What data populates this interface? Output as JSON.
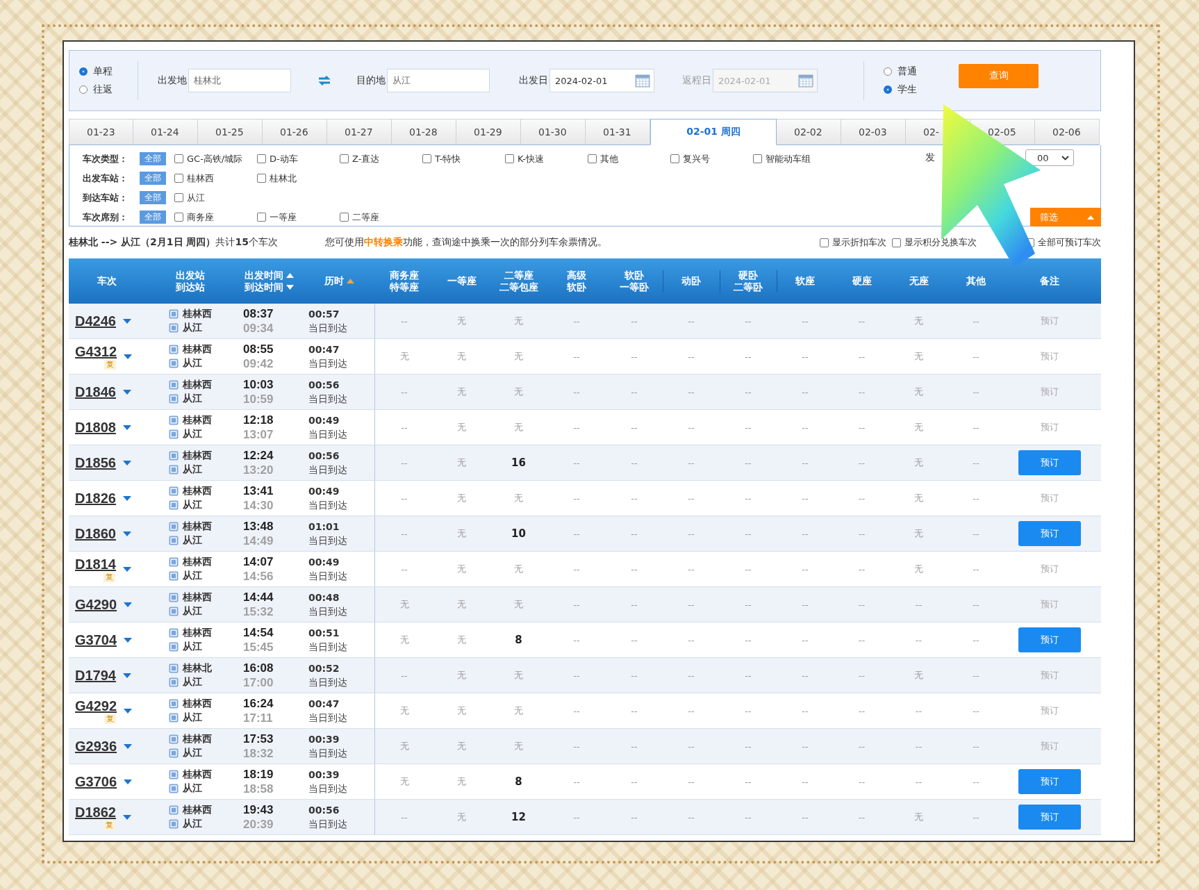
{
  "trip_type": [
    {
      "label": "单程",
      "selected": true
    },
    {
      "label": "往返",
      "selected": false
    }
  ],
  "from": {
    "label": "出发地",
    "value": "桂林北"
  },
  "to": {
    "label": "目的地",
    "value": "从江"
  },
  "depart_date": {
    "label": "出发日",
    "value": "2024-02-01",
    "disabled": false
  },
  "return_date": {
    "label": "返程日",
    "value": "2024-02-01",
    "disabled": true
  },
  "ticket_type": [
    {
      "label": "普通",
      "selected": false
    },
    {
      "label": "学生",
      "selected": true
    }
  ],
  "query_button": "查询",
  "date_tabs": [
    {
      "label": "01-23",
      "selected": false
    },
    {
      "label": "01-24",
      "selected": false
    },
    {
      "label": "01-25",
      "selected": false
    },
    {
      "label": "01-26",
      "selected": false
    },
    {
      "label": "01-27",
      "selected": false
    },
    {
      "label": "01-28",
      "selected": false
    },
    {
      "label": "01-29",
      "selected": false
    },
    {
      "label": "01-30",
      "selected": false
    },
    {
      "label": "01-31",
      "selected": false
    },
    {
      "label": "02-01 周四",
      "selected": true
    },
    {
      "label": "02-02",
      "selected": false
    },
    {
      "label": "02-03",
      "selected": false
    },
    {
      "label": "02-",
      "selected": false
    },
    {
      "label": "02-05",
      "selected": false
    },
    {
      "label": "02-06",
      "selected": false
    }
  ],
  "filters": [
    {
      "label": "车次类型：",
      "all": {
        "label": "全部",
        "selected": true
      },
      "options": [
        {
          "label": "GC-高铁/城际",
          "checked": false
        },
        {
          "label": "D-动车",
          "checked": false
        },
        {
          "label": "Z-直达",
          "checked": false
        },
        {
          "label": "T-特快",
          "checked": false
        },
        {
          "label": "K-快速",
          "checked": false
        },
        {
          "label": "其他",
          "checked": false
        },
        {
          "label": "复兴号",
          "checked": false
        },
        {
          "label": "智能动车组",
          "checked": false
        }
      ]
    },
    {
      "label": "出发车站：",
      "all": {
        "label": "全部",
        "selected": true
      },
      "options": [
        {
          "label": "桂林西",
          "checked": false
        },
        {
          "label": "桂林北",
          "checked": false
        }
      ]
    },
    {
      "label": "到达车站：",
      "all": {
        "label": "全部",
        "selected": true
      },
      "options": [
        {
          "label": "从江",
          "checked": false
        }
      ]
    },
    {
      "label": "车次席别：",
      "all": {
        "label": "全部",
        "selected": true
      },
      "options": [
        {
          "label": "商务座",
          "checked": false
        },
        {
          "label": "一等座",
          "checked": false
        },
        {
          "label": "二等座",
          "checked": false
        }
      ]
    }
  ],
  "depart_time": {
    "label": "发",
    "value": "00"
  },
  "filter_button": "筛选",
  "summary": "**桂林北 --> 从江（2月1日 周四）**共计**15**个车次",
  "notice": {
    "before": "您可使用",
    "link": "中转换乘",
    "after": "功能，查询途中换乘一次的部分列车余票情况。"
  },
  "display_options": [
    {
      "label": "显示折扣车次",
      "checked": false
    },
    {
      "label": "显示积分兑换车次",
      "checked": false
    },
    {
      "label": "全部可预订车次",
      "checked": false
    }
  ],
  "table": {
    "columns": [
      {
        "lines": [
          "车次"
        ]
      },
      {
        "lines": [
          "出发站",
          "到达站"
        ]
      },
      {
        "lines": [
          "出发时间",
          "到达时间"
        ],
        "sortable": true,
        "sort_active": false
      },
      {
        "lines": [
          "历时"
        ],
        "sortable": true,
        "sort_active": true
      },
      {
        "lines": [
          "商务座",
          "特等座"
        ]
      },
      {
        "lines": [
          "一等座"
        ]
      },
      {
        "lines": [
          "二等座",
          "二等包座"
        ]
      },
      {
        "lines": [
          "高级",
          "软卧"
        ]
      },
      {
        "lines": [
          "软卧",
          "一等卧"
        ]
      },
      {
        "lines": [
          "动卧"
        ]
      },
      {
        "lines": [
          "硬卧",
          "二等卧"
        ]
      },
      {
        "lines": [
          "软座"
        ]
      },
      {
        "lines": [
          "硬座"
        ]
      },
      {
        "lines": [
          "无座"
        ]
      },
      {
        "lines": [
          "其他"
        ]
      },
      {
        "lines": [
          "备注"
        ]
      }
    ],
    "rows": [
      {
        "train": "D4246",
        "from": "桂林西",
        "to": "从江",
        "depart": "08:37",
        "arrive": "09:34",
        "duration": "00:57",
        "arrival_day": "当日到达",
        "seats": [
          "--",
          "无",
          "无",
          "--",
          "--",
          "--",
          "--",
          "--",
          "--",
          "无",
          "--"
        ],
        "book": {
          "label": "预订",
          "enabled": false
        }
      },
      {
        "train": "G4312",
        "badge": "复",
        "from": "桂林西",
        "to": "从江",
        "depart": "08:55",
        "arrive": "09:42",
        "duration": "00:47",
        "arrival_day": "当日到达",
        "seats": [
          "无",
          "无",
          "无",
          "--",
          "--",
          "--",
          "--",
          "--",
          "--",
          "无",
          "--"
        ],
        "book": {
          "label": "预订",
          "enabled": false
        }
      },
      {
        "train": "D1846",
        "from": "桂林西",
        "to": "从江",
        "depart": "10:03",
        "arrive": "10:59",
        "duration": "00:56",
        "arrival_day": "当日到达",
        "seats": [
          "--",
          "无",
          "无",
          "--",
          "--",
          "--",
          "--",
          "--",
          "--",
          "无",
          "--"
        ],
        "book": {
          "label": "预订",
          "enabled": false
        }
      },
      {
        "train": "D1808",
        "from": "桂林西",
        "to": "从江",
        "depart": "12:18",
        "arrive": "13:07",
        "duration": "00:49",
        "arrival_day": "当日到达",
        "seats": [
          "--",
          "无",
          "无",
          "--",
          "--",
          "--",
          "--",
          "--",
          "--",
          "无",
          "--"
        ],
        "book": {
          "label": "预订",
          "enabled": false
        }
      },
      {
        "train": "D1856",
        "from": "桂林西",
        "to": "从江",
        "depart": "12:24",
        "arrive": "13:20",
        "duration": "00:56",
        "arrival_day": "当日到达",
        "seats": [
          "--",
          "无",
          "16",
          "--",
          "--",
          "--",
          "--",
          "--",
          "--",
          "无",
          "--"
        ],
        "book": {
          "label": "预订",
          "enabled": true
        }
      },
      {
        "train": "D1826",
        "from": "桂林西",
        "to": "从江",
        "depart": "13:41",
        "arrive": "14:30",
        "duration": "00:49",
        "arrival_day": "当日到达",
        "seats": [
          "--",
          "无",
          "无",
          "--",
          "--",
          "--",
          "--",
          "--",
          "--",
          "无",
          "--"
        ],
        "book": {
          "label": "预订",
          "enabled": false
        }
      },
      {
        "train": "D1860",
        "from": "桂林西",
        "to": "从江",
        "depart": "13:48",
        "arrive": "14:49",
        "duration": "01:01",
        "arrival_day": "当日到达",
        "seats": [
          "--",
          "无",
          "10",
          "--",
          "--",
          "--",
          "--",
          "--",
          "--",
          "无",
          "--"
        ],
        "book": {
          "label": "预订",
          "enabled": true
        }
      },
      {
        "train": "D1814",
        "badge": "复",
        "from": "桂林西",
        "to": "从江",
        "depart": "14:07",
        "arrive": "14:56",
        "duration": "00:49",
        "arrival_day": "当日到达",
        "seats": [
          "--",
          "无",
          "无",
          "--",
          "--",
          "--",
          "--",
          "--",
          "--",
          "无",
          "--"
        ],
        "book": {
          "label": "预订",
          "enabled": false
        }
      },
      {
        "train": "G4290",
        "from": "桂林西",
        "to": "从江",
        "depart": "14:44",
        "arrive": "15:32",
        "duration": "00:48",
        "arrival_day": "当日到达",
        "seats": [
          "无",
          "无",
          "无",
          "--",
          "--",
          "--",
          "--",
          "--",
          "--",
          "--",
          "--"
        ],
        "book": {
          "label": "预订",
          "enabled": false
        }
      },
      {
        "train": "G3704",
        "from": "桂林西",
        "to": "从江",
        "depart": "14:54",
        "arrive": "15:45",
        "duration": "00:51",
        "arrival_day": "当日到达",
        "seats": [
          "无",
          "无",
          "8",
          "--",
          "--",
          "--",
          "--",
          "--",
          "--",
          "--",
          "--"
        ],
        "book": {
          "label": "预订",
          "enabled": true
        }
      },
      {
        "train": "D1794",
        "from": "桂林北",
        "to": "从江",
        "depart": "16:08",
        "arrive": "17:00",
        "duration": "00:52",
        "arrival_day": "当日到达",
        "seats": [
          "--",
          "无",
          "无",
          "--",
          "--",
          "--",
          "--",
          "--",
          "--",
          "无",
          "--"
        ],
        "book": {
          "label": "预订",
          "enabled": false
        }
      },
      {
        "train": "G4292",
        "badge": "复",
        "from": "桂林西",
        "to": "从江",
        "depart": "16:24",
        "arrive": "17:11",
        "duration": "00:47",
        "arrival_day": "当日到达",
        "seats": [
          "无",
          "无",
          "无",
          "--",
          "--",
          "--",
          "--",
          "--",
          "--",
          "--",
          "--"
        ],
        "book": {
          "label": "预订",
          "enabled": false
        }
      },
      {
        "train": "G2936",
        "from": "桂林西",
        "to": "从江",
        "depart": "17:53",
        "arrive": "18:32",
        "duration": "00:39",
        "arrival_day": "当日到达",
        "seats": [
          "无",
          "无",
          "无",
          "--",
          "--",
          "--",
          "--",
          "--",
          "--",
          "--",
          "--"
        ],
        "book": {
          "label": "预订",
          "enabled": false
        }
      },
      {
        "train": "G3706",
        "from": "桂林西",
        "to": "从江",
        "depart": "18:19",
        "arrive": "18:58",
        "duration": "00:39",
        "arrival_day": "当日到达",
        "seats": [
          "无",
          "无",
          "8",
          "--",
          "--",
          "--",
          "--",
          "--",
          "--",
          "--",
          "--"
        ],
        "book": {
          "label": "预订",
          "enabled": true
        }
      },
      {
        "train": "D1862",
        "badge": "复",
        "from": "桂林西",
        "to": "从江",
        "depart": "19:43",
        "arrive": "20:39",
        "duration": "00:56",
        "arrival_day": "当日到达",
        "seats": [
          "--",
          "无",
          "12",
          "--",
          "--",
          "--",
          "--",
          "--",
          "--",
          "无",
          "--"
        ],
        "book": {
          "label": "预订",
          "enabled": true
        }
      }
    ]
  }
}
